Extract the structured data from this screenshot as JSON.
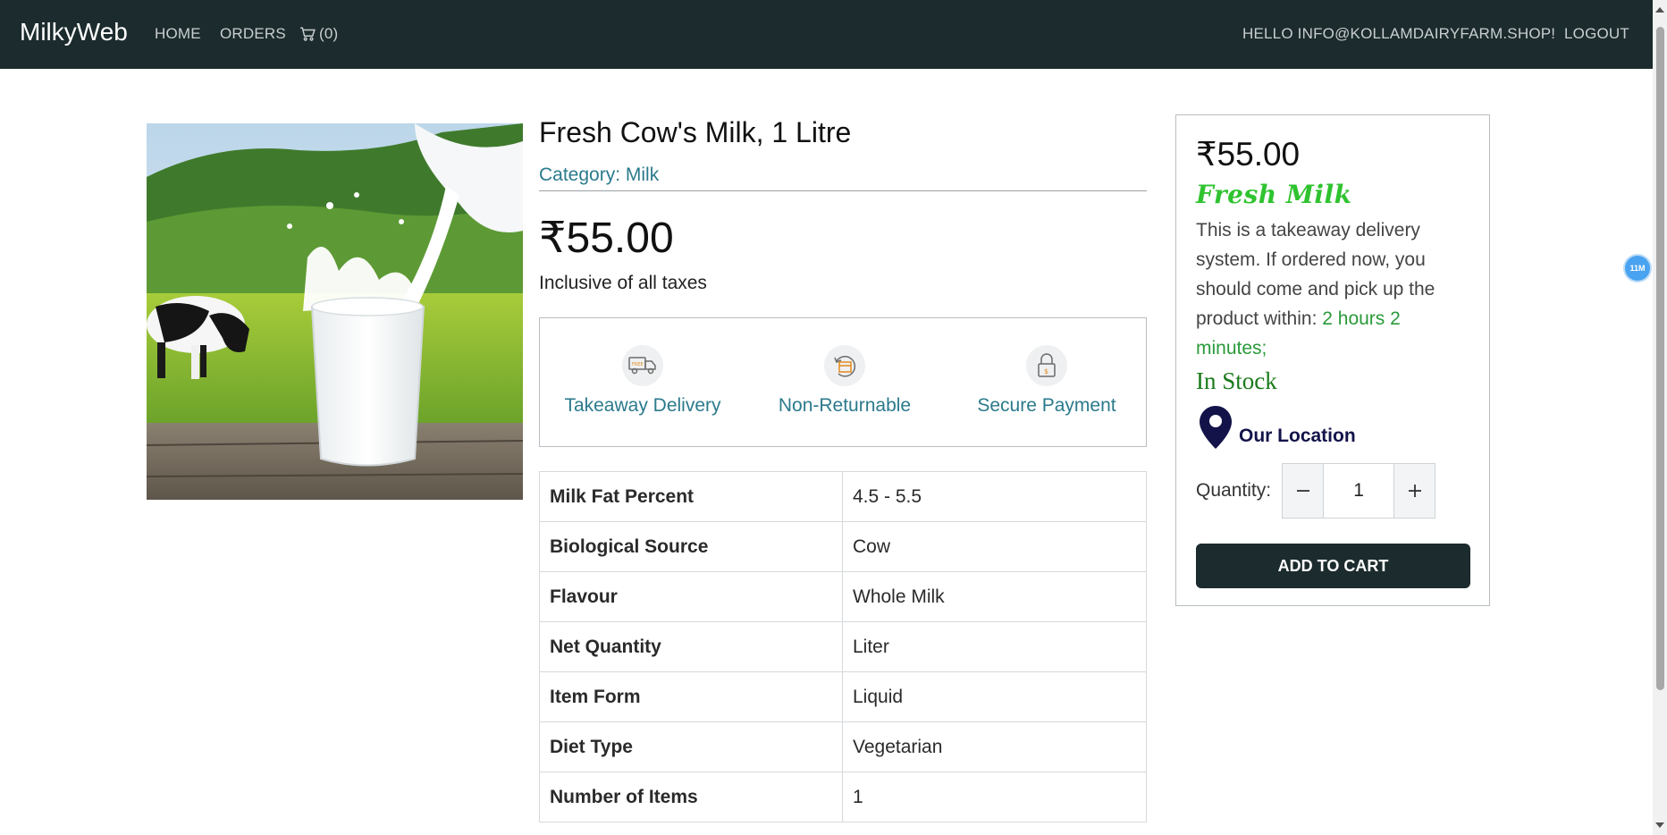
{
  "nav": {
    "brand": "MilkyWeb",
    "home": "HOME",
    "orders": "ORDERS",
    "cart_count": "(0)",
    "greeting": "HELLO INFO@KOLLAMDAIRYFARM.SHOP!",
    "logout": "LOGOUT"
  },
  "product": {
    "title": "Fresh Cow's Milk, 1 Litre",
    "category": "Category: Milk",
    "price": "₹55.00",
    "inclusive": "Inclusive of all taxes",
    "features": [
      {
        "label": "Takeaway Delivery",
        "icon": "free-delivery-truck-icon"
      },
      {
        "label": "Non-Returnable",
        "icon": "non-returnable-box-icon"
      },
      {
        "label": "Secure Payment",
        "icon": "secure-payment-lock-icon"
      }
    ],
    "specs": [
      {
        "key": "Milk Fat Percent",
        "value": "4.5 - 5.5"
      },
      {
        "key": "Biological Source",
        "value": "Cow"
      },
      {
        "key": "Flavour",
        "value": "Whole Milk"
      },
      {
        "key": "Net Quantity",
        "value": "Liter"
      },
      {
        "key": "Item Form",
        "value": "Liquid"
      },
      {
        "key": "Diet Type",
        "value": "Vegetarian"
      },
      {
        "key": "Number of Items",
        "value": "1"
      }
    ]
  },
  "buybox": {
    "price": "₹55.00",
    "tagline": "Fresh Milk",
    "description": "This is a takeaway delivery system. If ordered now, you should come and pick up the product within: ",
    "pickup_time": "2 hours 2 minutes;",
    "stock": "In Stock",
    "location_label": "Our Location",
    "quantity_label": "Quantity:",
    "quantity_value": "1",
    "add_to_cart": "ADD TO CART"
  },
  "badge": "11M",
  "colors": {
    "navbar": "#1c2b2d",
    "accent_link": "#2b7a8c",
    "fresh_green": "#2fc32f",
    "stock_green": "#1a7a1a"
  }
}
